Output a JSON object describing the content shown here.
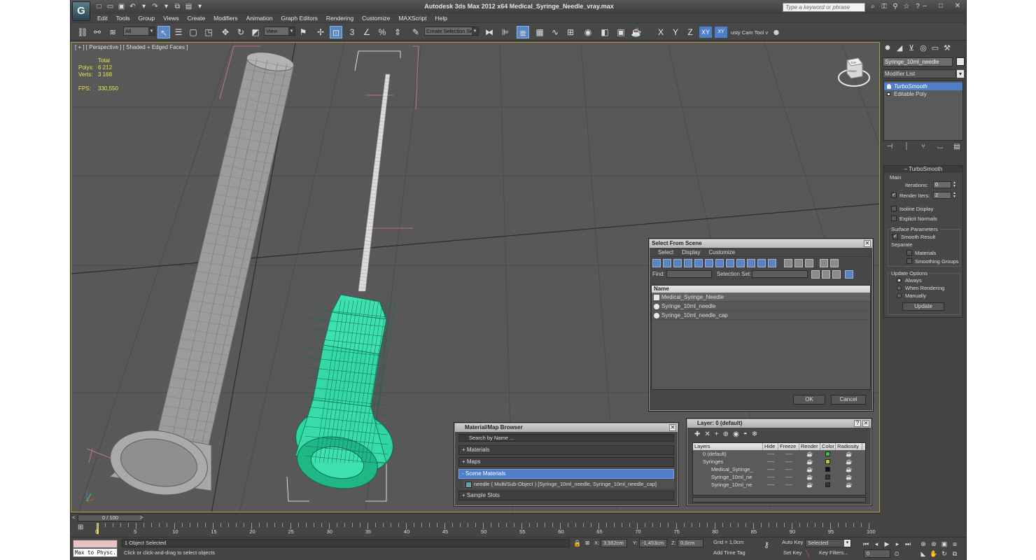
{
  "window": {
    "title": "Autodesk 3ds Max  2012 x64     Medical_Syringe_Needle_vray.max",
    "search_placeholder": "Type a keyword or phrase"
  },
  "menu": [
    "Edit",
    "Tools",
    "Group",
    "Views",
    "Create",
    "Modifiers",
    "Animation",
    "Graph Editors",
    "Rendering",
    "Customize",
    "MAXScript",
    "Help"
  ],
  "toolbar": {
    "filter": "All",
    "ref_coord": "View",
    "named_selection": "Create Selection Se",
    "axes": [
      "X",
      "Y",
      "Z",
      "XY"
    ],
    "axis_active": "XY",
    "ruler_label": "usty Cam Tool v"
  },
  "viewport": {
    "label": "[ + ] [ Perspective ] [ Shaded + Edged Faces ]",
    "stats": {
      "total_label": "Total",
      "polys_label": "Polys:",
      "polys": "6 212",
      "verts_label": "Verts:",
      "verts": "3 168",
      "fps_label": "FPS:",
      "fps": "330,550"
    },
    "viewcube_label": "TOP",
    "viewcube_front": "FRONT"
  },
  "select_from_scene": {
    "title": "Select From Scene",
    "menus": [
      "Select",
      "Display",
      "Customize"
    ],
    "find_label": "Find:",
    "selection_set_label": "Selection Set:",
    "column_name": "Name",
    "items": [
      "Medical_Syringe_Needle",
      "Syringe_10ml_needle",
      "Syringe_10ml_needle_cap"
    ],
    "ok": "OK",
    "cancel": "Cancel"
  },
  "material_browser": {
    "title": "Material/Map Browser",
    "search": "Search by Name ...",
    "sections": {
      "materials": "+ Materials",
      "maps": "+ Maps",
      "scene_materials": "- Scene Materials",
      "scene_material_item": "needle  ( Multi/Sub-Object ) [Syringe_10ml_needle, Syringe_10ml_needle_cap]",
      "sample_slots": "+ Sample Slots"
    }
  },
  "layer_manager": {
    "title": "Layer: 0 (default)",
    "columns": [
      "Layers",
      "Hide",
      "Freeze",
      "Render",
      "Color",
      "Radiosity"
    ],
    "rows": [
      {
        "name": "0 (default)",
        "color": "#39c339"
      },
      {
        "name": "Syringes",
        "color": "#a0d82c"
      },
      {
        "name": "Medical_Syringe_",
        "color": "#111111"
      },
      {
        "name": "Syringe_10ml_ne",
        "color": "#333333"
      },
      {
        "name": "Syringe_10ml_ne",
        "color": "#333333"
      }
    ],
    "dashes": "----"
  },
  "command_panel": {
    "object_name": "Syringe_10ml_needle",
    "modifier_list": "Modifier List",
    "stack": [
      "TurboSmooth",
      "Editable Poly"
    ],
    "turbosmooth": {
      "title": "TurboSmooth",
      "main": "Main",
      "iterations_label": "Iterations:",
      "iterations": "0",
      "render_iters_label": "Render Iters:",
      "render_iters": "2",
      "isoline": "Isoline Display",
      "explicit_normals": "Explicit Normals",
      "surface_params": "Surface Parameters",
      "smooth_result": "Smooth Result",
      "separate": "Separate",
      "materials": "Materials",
      "smoothing_groups": "Smoothing Groups",
      "update_options": "Update Options",
      "always": "Always",
      "when_rendering": "When Rendering",
      "manually": "Manually",
      "update": "Update"
    }
  },
  "timeline": {
    "frame": "0 / 100",
    "ticks": [
      "0",
      "5",
      "10",
      "15",
      "20",
      "25",
      "30",
      "35",
      "40",
      "45",
      "50",
      "55",
      "60",
      "65",
      "70",
      "75",
      "80",
      "85",
      "90",
      "95",
      "100"
    ]
  },
  "status": {
    "listener": "Max to Physc.",
    "selected": "1 Object Selected",
    "prompt": "Click or click-and-drag to select objects",
    "x_label": "X:",
    "x": "3,562cm",
    "y_label": "Y:",
    "y": "-1,453cm",
    "z_label": "Z:",
    "z": "0,0cm",
    "grid": "Grid = 1,0cm",
    "add_time_tag": "Add Time Tag",
    "auto_key": "Auto Key",
    "set_key": "Set Key",
    "selected_set": "Selected",
    "key_filters": "Key Filters...",
    "frame": "0"
  }
}
